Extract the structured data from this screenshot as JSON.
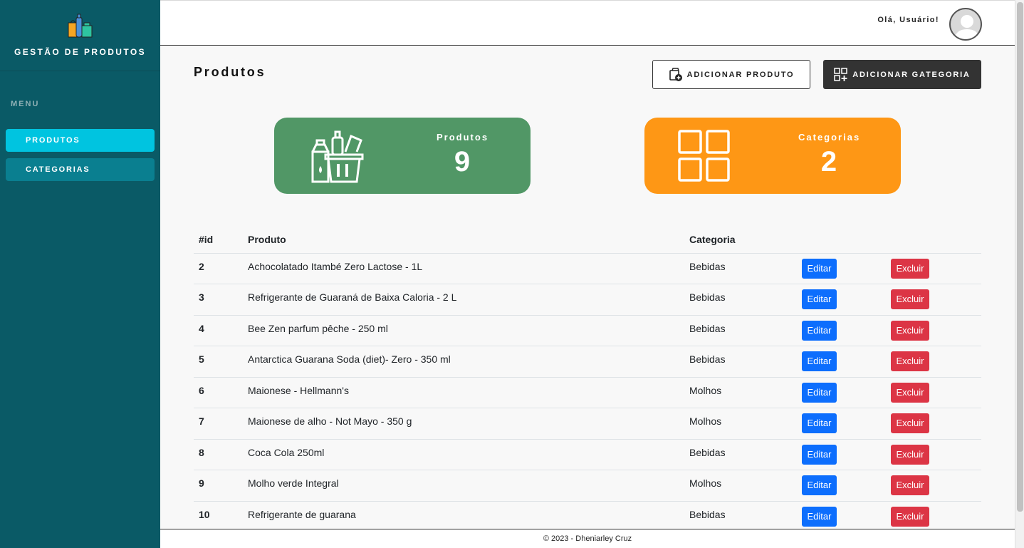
{
  "sidebar": {
    "brand": "GESTÃO DE PRODUTOS",
    "menu_label": "MENU",
    "items": [
      {
        "label": "PRODUTOS",
        "active": true
      },
      {
        "label": "CATEGORIAS",
        "active": false
      }
    ]
  },
  "header": {
    "greeting": "Olá, Usuário!"
  },
  "page": {
    "title": "Produtos",
    "add_product_label": "ADICIONAR PRODUTO",
    "add_category_label": "ADICIONAR GATEGORIA"
  },
  "cards": {
    "products": {
      "label": "Produtos",
      "value": "9",
      "color": "#519766"
    },
    "categories": {
      "label": "Categorias",
      "value": "2",
      "color": "#fe9715"
    }
  },
  "table": {
    "headers": {
      "id": "#id",
      "product": "Produto",
      "category": "Categoria"
    },
    "edit_label": "Editar",
    "delete_label": "Excluir",
    "rows": [
      {
        "id": "2",
        "product": "Achocolatado Itambé Zero Lactose - 1L",
        "category": "Bebidas"
      },
      {
        "id": "3",
        "product": "Refrigerante de Guaraná de Baixa Caloria - 2 L",
        "category": "Bebidas"
      },
      {
        "id": "4",
        "product": "Bee Zen parfum pêche - 250 ml",
        "category": "Bebidas"
      },
      {
        "id": "5",
        "product": "Antarctica Guarana Soda (diet)- Zero - 350 ml",
        "category": "Bebidas"
      },
      {
        "id": "6",
        "product": "Maionese - Hellmann's",
        "category": "Molhos"
      },
      {
        "id": "7",
        "product": "Maionese de alho - Not Mayo - 350 g",
        "category": "Molhos"
      },
      {
        "id": "8",
        "product": "Coca Cola 250ml",
        "category": "Bebidas"
      },
      {
        "id": "9",
        "product": "Molho verde Integral",
        "category": "Molhos"
      },
      {
        "id": "10",
        "product": "Refrigerante de guarana",
        "category": "Bebidas"
      }
    ]
  },
  "footer": {
    "text": "© 2023 - Dheniarley Cruz"
  },
  "colors": {
    "sidebar_bg": "#0a5a66",
    "nav_active": "#00c4e0",
    "nav_normal": "#0a7f90",
    "edit_button": "#0d6efd",
    "delete_button": "#dc3545"
  }
}
